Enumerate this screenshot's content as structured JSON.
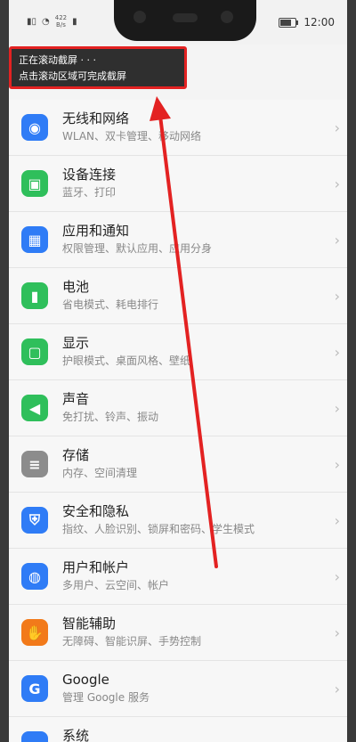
{
  "statusbar": {
    "left_speed_top": "422",
    "left_speed_bottom": "B/s",
    "time": "12:00"
  },
  "toast": {
    "line1": "正在滚动截屏 · · ·",
    "line2": "点击滚动区域可完成截屏"
  },
  "settings": [
    {
      "title": "无线和网络",
      "subtitle": "WLAN、双卡管理、移动网络",
      "icon": "wifi-icon",
      "color": "#2f7cf6"
    },
    {
      "title": "设备连接",
      "subtitle": "蓝牙、打印",
      "icon": "device-connection-icon",
      "color": "#2fbf5b"
    },
    {
      "title": "应用和通知",
      "subtitle": "权限管理、默认应用、应用分身",
      "icon": "apps-icon",
      "color": "#2f7cf6"
    },
    {
      "title": "电池",
      "subtitle": "省电模式、耗电排行",
      "icon": "battery-icon",
      "color": "#2fbf5b"
    },
    {
      "title": "显示",
      "subtitle": "护眼模式、桌面风格、壁纸",
      "icon": "display-icon",
      "color": "#2fbf5b"
    },
    {
      "title": "声音",
      "subtitle": "免打扰、铃声、振动",
      "icon": "sound-icon",
      "color": "#2fbf5b"
    },
    {
      "title": "存储",
      "subtitle": "内存、空间清理",
      "icon": "storage-icon",
      "color": "#8c8c8c"
    },
    {
      "title": "安全和隐私",
      "subtitle": "指纹、人脸识别、锁屏和密码、学生模式",
      "icon": "shield-icon",
      "color": "#2f7cf6"
    },
    {
      "title": "用户和帐户",
      "subtitle": "多用户、云空间、帐户",
      "icon": "user-icon",
      "color": "#2f7cf6"
    },
    {
      "title": "智能辅助",
      "subtitle": "无障碍、智能识屏、手势控制",
      "icon": "hand-icon",
      "color": "#f27a1a"
    },
    {
      "title": "Google",
      "subtitle": "管理 Google 服务",
      "icon": "google-icon",
      "color": "#2f7cf6"
    },
    {
      "title": "系统",
      "subtitle": "",
      "icon": "system-icon",
      "color": "#2f7cf6"
    }
  ]
}
